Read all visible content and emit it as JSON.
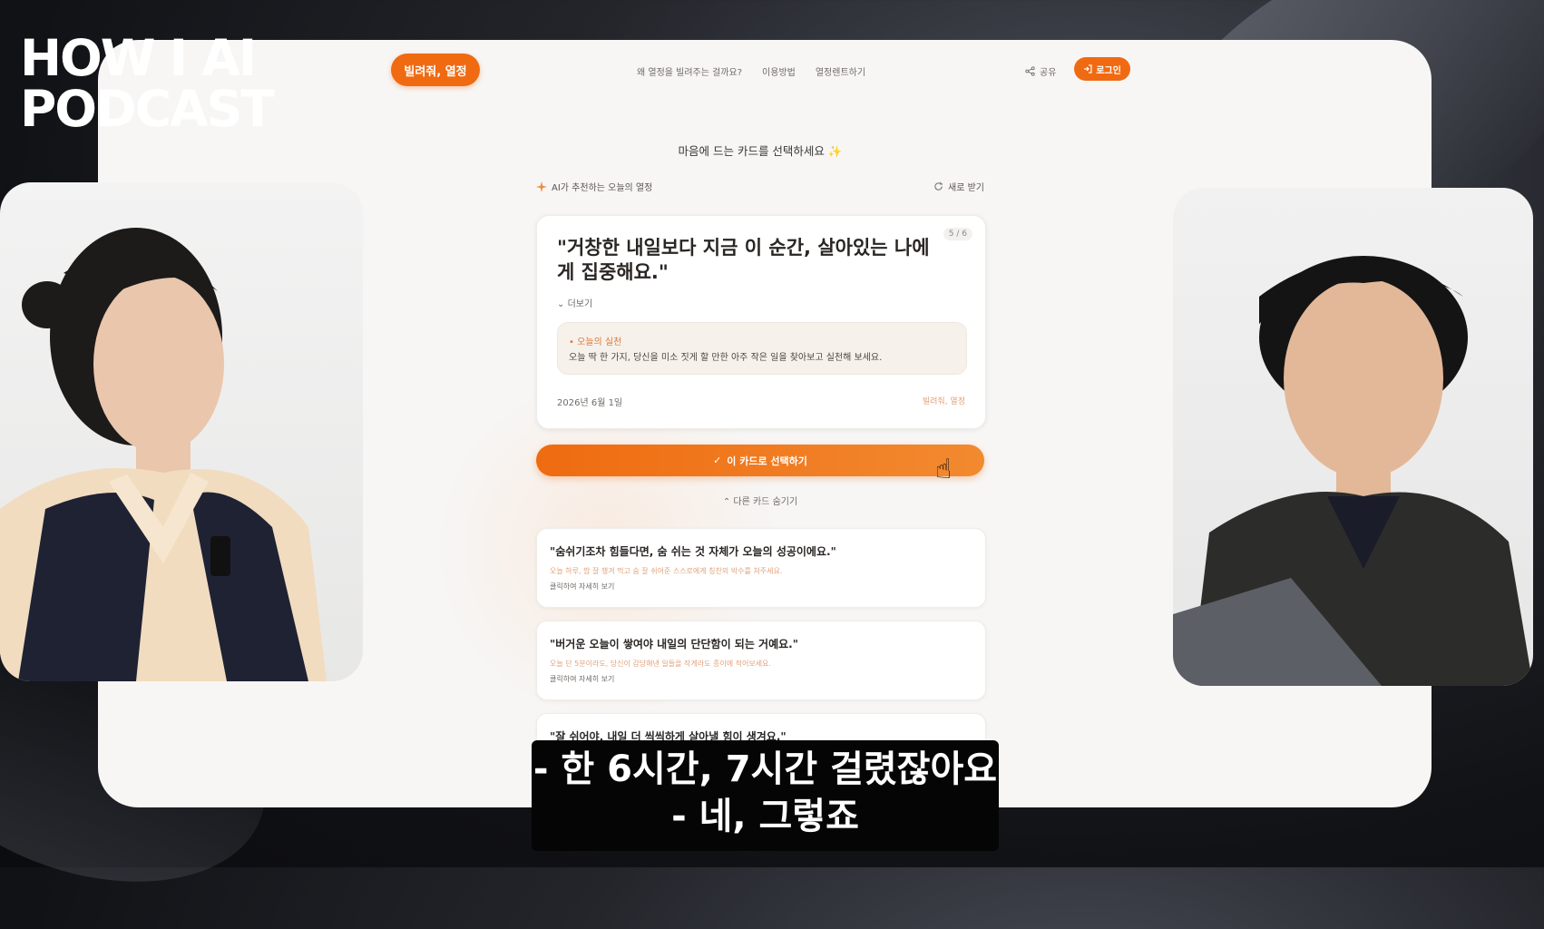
{
  "overlay": {
    "logo_line1": "HOW I AI",
    "logo_line2": "PODCAST"
  },
  "nav": {
    "brand": "빌려줘, 열정",
    "links": [
      "왜 열정을 빌려주는 걸까요?",
      "이용방법",
      "열정렌트하기"
    ],
    "share": "공유",
    "login": "로그인"
  },
  "page": {
    "headline": "마음에 드는 카드를 선택하세요 ✨",
    "ai_label": "AI가 추천하는 오늘의 열정",
    "refresh_label": "새로 받기"
  },
  "main_card": {
    "counter": "5 / 6",
    "quote": "\"거창한 내일보다 지금 이 순간, 살아있는 나에게 집중해요.\"",
    "more": "더보기",
    "practice_title": "오늘의 실천",
    "practice_text": "오늘 딱 한 가지, 당신을 미소 짓게 할 만한 아주 작은 일을 찾아보고 실천해 보세요.",
    "date": "2026년 6월 1일",
    "tags": "빌려줘, 열정"
  },
  "select_button": "이 카드로 선택하기",
  "hide_others": "다른 카드 숨기기",
  "alt_cards": [
    {
      "quote": "\"숨쉬기조차 힘들다면, 숨 쉬는 것 자체가 오늘의 성공이에요.\"",
      "tip": "오늘 하루, 밥 잘 챙겨 먹고 숨 잘 쉬어준 스스로에게 칭찬의 박수를 쳐주세요.",
      "detail": "클릭하여 자세히 보기"
    },
    {
      "quote": "\"버거운 오늘이 쌓여야 내일의 단단함이 되는 거예요.\"",
      "tip": "오늘 단 5분이라도, 당신이 감당해낸 일들을 작게라도 종이에 적어보세요.",
      "detail": "클릭하여 자세히 보기"
    },
    {
      "quote": "\"잘 쉬어야, 내일 더 씩씩하게 살아낼 힘이 생겨요.\"",
      "tip": "",
      "detail": ""
    }
  ],
  "subtitle": {
    "line1": "- 한 6시간, 7시간 걸렸잖아요",
    "line2": "- 네, 그렇죠"
  },
  "colors": {
    "accent": "#f06a12",
    "background": "#f7f6f5"
  }
}
